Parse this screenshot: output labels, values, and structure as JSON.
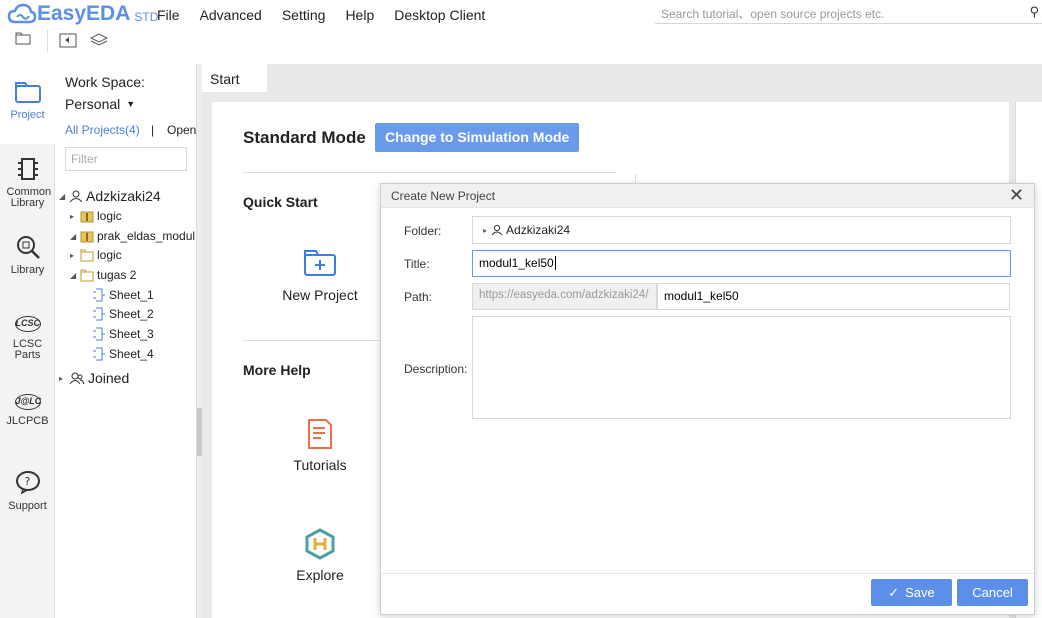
{
  "app": {
    "brand": "EasyEDA",
    "edition": "STD"
  },
  "menu": [
    "File",
    "Advanced",
    "Setting",
    "Help",
    "Desktop Client"
  ],
  "search": {
    "placeholder": "Search tutorial、open source projects etc."
  },
  "rail": [
    {
      "label": "Project",
      "icon": "folder-icon"
    },
    {
      "label": "Common Library",
      "icon": "chip-icon"
    },
    {
      "label": "Library",
      "icon": "magnifier-chip-icon"
    },
    {
      "label": "LCSC Parts",
      "icon": "lcsc-icon"
    },
    {
      "label": "JLCPCB",
      "icon": "jlc-icon"
    },
    {
      "label": "Support",
      "icon": "help-icon"
    }
  ],
  "sidebar": {
    "workspace_label": "Work Space:",
    "workspace_value": "Personal",
    "all_projects": "All Projects(4)",
    "separator": "|",
    "open_label": "Open",
    "filter_placeholder": "Filter",
    "tree": {
      "owner": "Adzkizaki24",
      "items": [
        "logic",
        "prak_eldas_modul",
        "logic",
        "tugas 2"
      ],
      "sheets": [
        "Sheet_1",
        "Sheet_2",
        "Sheet_3",
        "Sheet_4"
      ],
      "joined": "Joined"
    }
  },
  "tabs": {
    "start": "Start"
  },
  "start": {
    "standard_mode": "Standard Mode",
    "change_mode": "Change to Simulation Mode",
    "quick_start": "Quick Start",
    "new_project": "New Project",
    "more_help": "More Help",
    "tutorials": "Tutorials",
    "explore": "Explore"
  },
  "dialog": {
    "title": "Create New Project",
    "folder_label": "Folder:",
    "folder_value": "Adzkizaki24",
    "title_label": "Title:",
    "title_value": "modul1_kel50",
    "path_label": "Path:",
    "path_prefix": "https://easyeda.com/adzkizaki24/",
    "path_value": "modul1_kel50",
    "description_label": "Description:",
    "description_value": "",
    "save": "Save",
    "cancel": "Cancel"
  },
  "colors": {
    "accent": "#5b8fe8",
    "bg": "#e9e9e9"
  }
}
